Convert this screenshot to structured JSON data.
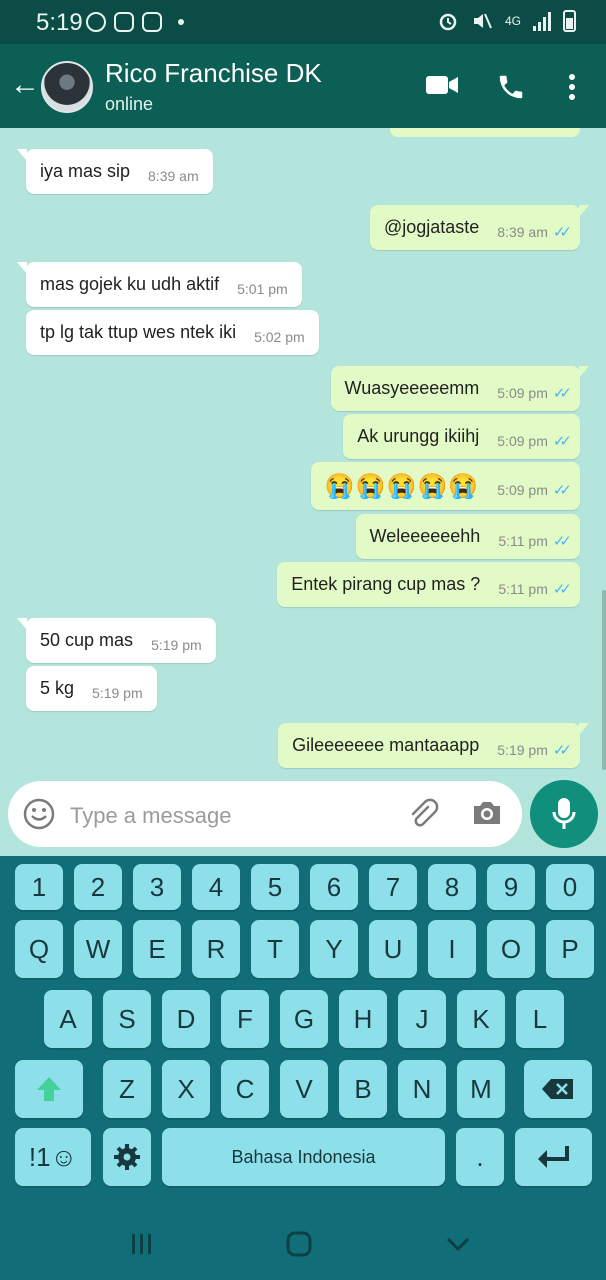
{
  "status_bar": {
    "time": "5:19",
    "network": "4G",
    "left_icons": [
      "whatsapp-status-icon",
      "instagram-icon",
      "instagram-icon-2"
    ],
    "right_icons": [
      "alarm-icon",
      "mute-icon",
      "network-4g-icon",
      "signal-icon",
      "battery-icon"
    ]
  },
  "header": {
    "contact_name": "Rico Franchise DK",
    "status": "online",
    "icons": [
      "back-arrow-icon",
      "video-call-icon",
      "phone-call-icon",
      "more-options-icon"
    ]
  },
  "messages": [
    {
      "dir": "in",
      "text": "iya mas sip",
      "time": "8:39 am"
    },
    {
      "dir": "out",
      "text": "@jogjataste",
      "time": "8:39 am",
      "status": "read"
    },
    {
      "dir": "in",
      "text": "mas gojek ku udh aktif",
      "time": "5:01 pm"
    },
    {
      "dir": "in",
      "text": "tp lg tak ttup wes ntek iki",
      "time": "5:02 pm"
    },
    {
      "dir": "out",
      "text": "Wuasyeeeeemm",
      "time": "5:09 pm",
      "status": "read"
    },
    {
      "dir": "out",
      "text": "Ak urungg ikiihj",
      "time": "5:09 pm",
      "status": "read"
    },
    {
      "dir": "out",
      "text": "😭😭😭😭😭",
      "time": "5:09 pm",
      "status": "read"
    },
    {
      "dir": "out",
      "text": "Weleeeeeehh",
      "time": "5:11 pm",
      "status": "read"
    },
    {
      "dir": "out",
      "text": "Entek pirang cup mas ?",
      "time": "5:11 pm",
      "status": "read"
    },
    {
      "dir": "in",
      "text": "50 cup mas",
      "time": "5:19 pm"
    },
    {
      "dir": "in",
      "text": "5 kg",
      "time": "5:19 pm"
    },
    {
      "dir": "out",
      "text": "Gileeeeeee mantaaapp",
      "time": "5:19 pm",
      "status": "read"
    }
  ],
  "read_ticks": "✓✓",
  "input": {
    "placeholder": "Type a message",
    "icons": [
      "emoji-icon",
      "attach-icon",
      "camera-icon",
      "mic-icon"
    ]
  },
  "keyboard": {
    "row_numbers": [
      "1",
      "2",
      "3",
      "4",
      "5",
      "6",
      "7",
      "8",
      "9",
      "0"
    ],
    "row1": [
      "Q",
      "W",
      "E",
      "R",
      "T",
      "Y",
      "U",
      "I",
      "O",
      "P"
    ],
    "row2": [
      "A",
      "S",
      "D",
      "F",
      "G",
      "H",
      "J",
      "K",
      "L"
    ],
    "row3": [
      "Z",
      "X",
      "C",
      "V",
      "B",
      "N",
      "M"
    ],
    "symbols_label": "!1☺",
    "space_label": "Bahasa Indonesia",
    "period_label": ".",
    "colors": {
      "background": "#116e78",
      "key": "#8ddfe9",
      "shift_arrow": "#45d19b"
    }
  },
  "nav_bar": {
    "icons": [
      "recent-apps-icon",
      "home-icon",
      "back-nav-icon"
    ]
  }
}
